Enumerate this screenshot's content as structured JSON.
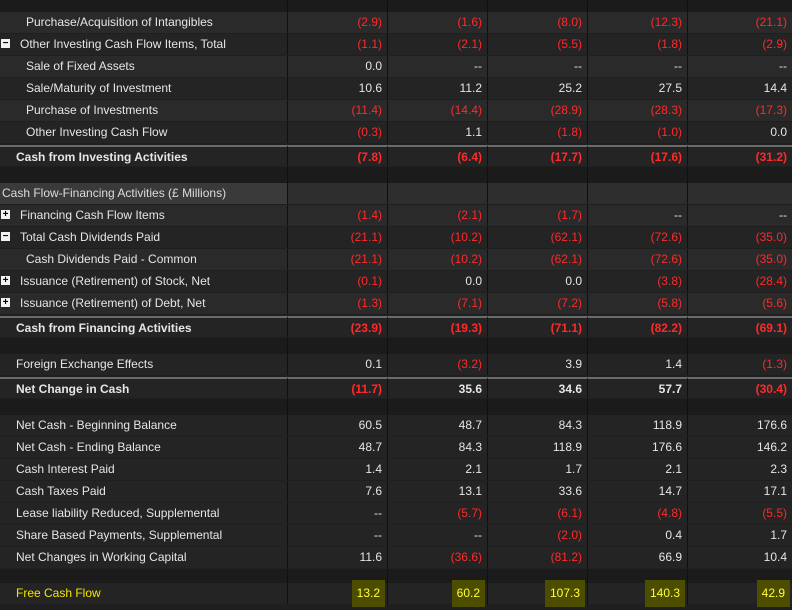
{
  "rows": [
    {
      "label": "Purchase/Acquisition of Intangibles",
      "values": [
        "(2.9)",
        "(1.6)",
        "(8.0)",
        "(12.3)",
        "(21.1)"
      ]
    },
    {
      "label": "Other Investing Cash Flow Items, Total",
      "toggle": "−",
      "values": [
        "(1.1)",
        "(2.1)",
        "(5.5)",
        "(1.8)",
        "(2.9)"
      ]
    },
    {
      "label": "Sale of Fixed Assets",
      "values": [
        "0.0",
        "--",
        "--",
        "--",
        "--"
      ]
    },
    {
      "label": "Sale/Maturity of Investment",
      "values": [
        "10.6",
        "11.2",
        "25.2",
        "27.5",
        "14.4"
      ]
    },
    {
      "label": "Purchase of Investments",
      "values": [
        "(11.4)",
        "(14.4)",
        "(28.9)",
        "(28.3)",
        "(17.3)"
      ]
    },
    {
      "label": "Other Investing Cash Flow",
      "values": [
        "(0.3)",
        "1.1",
        "(1.8)",
        "(1.0)",
        "0.0"
      ]
    },
    {
      "label": "Cash from Investing Activities",
      "values": [
        "(7.8)",
        "(6.4)",
        "(17.7)",
        "(17.6)",
        "(31.2)"
      ]
    },
    {
      "label": "Cash Flow-Financing Activities (£ Millions)"
    },
    {
      "label": "Financing Cash Flow Items",
      "toggle": "+",
      "values": [
        "(1.4)",
        "(2.1)",
        "(1.7)",
        "--",
        "--"
      ]
    },
    {
      "label": "Total Cash Dividends Paid",
      "toggle": "−",
      "values": [
        "(21.1)",
        "(10.2)",
        "(62.1)",
        "(72.6)",
        "(35.0)"
      ]
    },
    {
      "label": "Cash Dividends Paid - Common",
      "values": [
        "(21.1)",
        "(10.2)",
        "(62.1)",
        "(72.6)",
        "(35.0)"
      ]
    },
    {
      "label": "Issuance (Retirement) of Stock, Net",
      "toggle": "+",
      "values": [
        "(0.1)",
        "0.0",
        "0.0",
        "(3.8)",
        "(28.4)"
      ]
    },
    {
      "label": "Issuance (Retirement) of Debt, Net",
      "toggle": "+",
      "values": [
        "(1.3)",
        "(7.1)",
        "(7.2)",
        "(5.8)",
        "(5.6)"
      ]
    },
    {
      "label": "Cash from Financing Activities",
      "values": [
        "(23.9)",
        "(19.3)",
        "(71.1)",
        "(82.2)",
        "(69.1)"
      ]
    },
    {
      "label": "Foreign Exchange Effects",
      "values": [
        "0.1",
        "(3.2)",
        "3.9",
        "1.4",
        "(1.3)"
      ]
    },
    {
      "label": "Net Change in Cash",
      "values": [
        "(11.7)",
        "35.6",
        "34.6",
        "57.7",
        "(30.4)"
      ]
    },
    {
      "label": "Net Cash - Beginning Balance",
      "values": [
        "60.5",
        "48.7",
        "84.3",
        "118.9",
        "176.6"
      ]
    },
    {
      "label": "Net Cash - Ending Balance",
      "values": [
        "48.7",
        "84.3",
        "118.9",
        "176.6",
        "146.2"
      ]
    },
    {
      "label": "Cash Interest Paid",
      "values": [
        "1.4",
        "2.1",
        "1.7",
        "2.1",
        "2.3"
      ]
    },
    {
      "label": "Cash Taxes Paid",
      "values": [
        "7.6",
        "13.1",
        "33.6",
        "14.7",
        "17.1"
      ]
    },
    {
      "label": "Lease liability Reduced, Supplemental",
      "values": [
        "--",
        "(5.7)",
        "(6.1)",
        "(4.8)",
        "(5.5)"
      ]
    },
    {
      "label": "Share Based Payments, Supplemental",
      "values": [
        "--",
        "--",
        "(2.0)",
        "0.4",
        "1.7"
      ]
    },
    {
      "label": "Net Changes in Working Capital",
      "values": [
        "11.6",
        "(36.6)",
        "(81.2)",
        "66.9",
        "10.4"
      ]
    },
    {
      "label": "Free Cash Flow",
      "values": [
        "13.2",
        "60.2",
        "107.3",
        "140.3",
        "42.9"
      ]
    }
  ],
  "colors": {
    "negative": "#ff2a2a",
    "highlight": "#f2e600",
    "background": "#1f1f1f"
  }
}
